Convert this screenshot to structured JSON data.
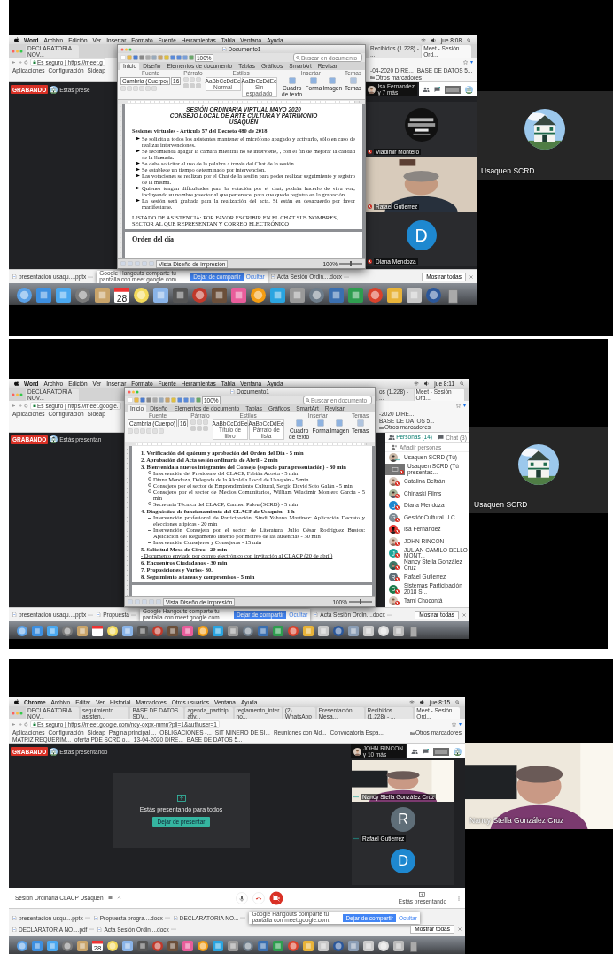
{
  "panels": [
    {
      "kind": "document",
      "menu_bar": {
        "app": "Word",
        "items": [
          "Archivo",
          "Edición",
          "Ver",
          "Insertar",
          "Formato",
          "Fuente",
          "Herramientas",
          "Tabla",
          "Ventana",
          "Ayuda"
        ],
        "clock": "jue 8:08"
      },
      "browser": {
        "tabs": {
          "left": [
            {
              "label": "DECLARATORIA NOV...",
              "selected": false
            }
          ],
          "right": [
            {
              "label": "Recibidos (1.228) - ...",
              "selected": false
            },
            {
              "label": "Meet - Sesión Ord...",
              "selected": true
            }
          ]
        },
        "address": "Es seguro | https://meet.g",
        "bookmarks": {
          "left": [
            "Aplicaciones",
            "Configuración",
            "Sideap"
          ],
          "right": [
            "-04-2020 DIRE...",
            "BASE DE DATOS 5...",
            "Otros marcadores"
          ]
        }
      },
      "meet": {
        "recording": "GRABANDO",
        "presenting": "Estás prese",
        "top_chip": {
          "name": "Isa Fernandez",
          "more": "y 7 más"
        },
        "tiles": [
          {
            "kind": "logo",
            "name": "Vladimir Montero",
            "muted": true
          },
          {
            "kind": "video",
            "name": "Rafael Gutierrez",
            "muted": true
          },
          {
            "kind": "letter",
            "letter": "D",
            "color": "#1e88d0",
            "name": "Diana Mendoza",
            "muted": true
          }
        ]
      },
      "word": {
        "title": "Documento1",
        "zoom": "100%",
        "search_placeholder": "Buscar en documento",
        "ribbon_tabs": [
          {
            "label": "Inicio",
            "selected": true
          },
          {
            "label": "Diseño",
            "selected": false
          },
          {
            "label": "Elementos de documento",
            "selected": false
          },
          {
            "label": "Tablas",
            "selected": false
          },
          {
            "label": "Gráficos",
            "selected": false
          },
          {
            "label": "SmartArt",
            "selected": false
          },
          {
            "label": "Revisar",
            "selected": false
          }
        ],
        "groups": [
          "Fuente",
          "Párrafo",
          "Estilos",
          "Insertar",
          "Temas"
        ],
        "font": "Cambria (Cuerpo)",
        "size": "16",
        "styles": [
          {
            "sample": "AaBbCcDdEe",
            "label": "Normal"
          },
          {
            "sample": "AaBbCcDdEe",
            "label": "Sin espaciado"
          }
        ],
        "insert": [
          "Cuadro de texto",
          "Forma",
          "Imagen"
        ],
        "themes": "Temas",
        "view": "Vista Diseño de impresión",
        "status_zoom": "100%",
        "zoom_slider": {
          "level": 0.5
        },
        "pages": [
          {
            "blocks": [
              {
                "kind": "title",
                "text": "SESIÓN ORDINARIA VIRTUAL MAYO 2020"
              },
              {
                "kind": "title",
                "text": "CONSEJO LOCAL DE ARTE CULTURA Y PATRIMONIO"
              },
              {
                "kind": "title",
                "text": "USAQUÉN"
              },
              {
                "kind": "heading",
                "text": "Sesiones virtuales - Artículo 57 del Decreto 480 de 2018"
              },
              {
                "kind": "bullet",
                "text": "Se solicita a todos los asistentes mantener el micrófono apagado y activarlo, sólo en caso de realizar intervenciones."
              },
              {
                "kind": "bullet",
                "text": "Se recomienda apagar la cámara mientras no se interviene, , con el fin de mejorar la calidad de la llamada."
              },
              {
                "kind": "bullet",
                "text": "Se debe solicitar el uso de la palabra a través del Chat de la sesión."
              },
              {
                "kind": "bullet",
                "text": "Se establece un tiempo determinado por intervención."
              },
              {
                "kind": "bullet",
                "text": "Las votaciones se realizan por el Chat de la sesión para poder realizar seguimiento y registro de la misma."
              },
              {
                "kind": "bullet",
                "text": "Quienes tengan dificultades para la votación por el chat, podrán hacerlo de viva voz, incluyendo su nombre y sector al que pertenece, para que quede registro en la grabación."
              },
              {
                "kind": "bullet",
                "text": "La sesión será grabada para la realización del acta. Si están en desacuerdo por favor manifestarse."
              },
              {
                "kind": "para",
                "text": "LISTADO DE ASISTENCIA: POR FAVOR ESCRIBIR EN EL CHAT SUS NOMBRES, SECTOR AL QUE REPRESENTAN Y CORREO ELECTRÓNICO"
              }
            ]
          },
          {
            "blocks": [
              {
                "kind": "section",
                "text": "Orden del día"
              }
            ]
          }
        ]
      },
      "downloads": {
        "left": [
          "presentacion usaqu....pptx"
        ],
        "right": [
          "Acta Sesión Ordin....docx"
        ],
        "show_all": "Mostrar todas"
      },
      "share_notice": {
        "text": "Google Hangouts comparte tu pantalla con meet.google.com.",
        "stop": "Dejar de compartir",
        "hide": "Ocultar"
      },
      "dock": {
        "calendar_day": "28"
      },
      "side_tile": {
        "kind": "avatar",
        "name": "Usaquen SCRD"
      }
    },
    {
      "kind": "document",
      "menu_bar": {
        "app": "Word",
        "items": [
          "Archivo",
          "Edición",
          "Ver",
          "Insertar",
          "Formato",
          "Fuente",
          "Herramientas",
          "Tabla",
          "Ventana",
          "Ayuda"
        ],
        "clock": "jue 8:11"
      },
      "browser": {
        "tabs": {
          "left": [
            {
              "label": "DECLARATORIA NOV...",
              "selected": false
            }
          ],
          "right": [
            {
              "label": "os (1.228) - ...",
              "selected": false
            },
            {
              "label": "Meet - Sesión Ord...",
              "selected": true
            }
          ]
        },
        "address": "Es seguro | https://meet.google.",
        "bookmarks": {
          "left": [
            "Aplicaciones",
            "Configuración",
            "Sideap"
          ],
          "right": [
            "-2020 DIRE...",
            "BASE DE DATOS 5...",
            "Otros marcadores"
          ]
        }
      },
      "meet": {
        "recording": "GRABANDO",
        "presenting": "Estás presentan",
        "people": {
          "tabs": [
            {
              "label": "Personas (14)",
              "selected": true
            },
            {
              "label": "Chat (3)",
              "selected": false
            }
          ],
          "add": "Añadir personas",
          "list": [
            {
              "name": "Usaquen SCRD (Tú)",
              "kind": "picture",
              "muted": false
            },
            {
              "name": "Usaquen SCRD (Tú presentas...",
              "kind": "screen",
              "muted": true
            },
            {
              "name": "Catalina Beltrán",
              "kind": "picture",
              "muted": true
            },
            {
              "name": "Chinaski Films",
              "kind": "picture",
              "muted": true
            },
            {
              "name": "Diana Mendoza",
              "kind": "letter",
              "letter": "D",
              "color": "#1e88d0",
              "muted": true
            },
            {
              "name": "GestiónCultural U.C",
              "kind": "letter",
              "letter": "G",
              "color": "#7d8a93",
              "muted": true
            },
            {
              "name": "Isa Fernandez",
              "kind": "picture",
              "muted": true
            },
            {
              "name": "JOHN RINCON",
              "kind": "picture",
              "muted": true
            },
            {
              "name": "JULIAN CAMILO BELLO MONT...",
              "kind": "letter",
              "letter": "J",
              "color": "#1ea59a",
              "muted": true
            },
            {
              "name": "Nancy Stella González Cruz",
              "kind": "picture",
              "muted": true
            },
            {
              "name": "Rafael Gutierrez",
              "kind": "letter",
              "letter": "R",
              "color": "#5f6e78",
              "muted": true
            },
            {
              "name": "Sistemas Participación 2018 S...",
              "kind": "letter",
              "letter": "S",
              "color": "#1b7a4a",
              "muted": true
            },
            {
              "name": "Tami Chocontá",
              "kind": "picture",
              "muted": true
            }
          ]
        }
      },
      "word": {
        "title": "Documento1",
        "zoom": "100%",
        "search_placeholder": "Buscar en documento",
        "ribbon_tabs": [
          {
            "label": "Inicio",
            "selected": true
          },
          {
            "label": "Diseño",
            "selected": false
          },
          {
            "label": "Elementos de documento",
            "selected": false
          },
          {
            "label": "Tablas",
            "selected": false
          },
          {
            "label": "Gráficos",
            "selected": false
          },
          {
            "label": "SmartArt",
            "selected": false
          },
          {
            "label": "Revisar",
            "selected": false
          }
        ],
        "groups": [
          "Fuente",
          "Párrafo",
          "Estilos",
          "Insertar",
          "Temas"
        ],
        "font": "Cambria (Cuerpo)",
        "size": "16",
        "styles": [
          {
            "sample": "AaBbCcDdEe",
            "label": "Título de libro"
          },
          {
            "sample": "AaBbCcDdEe",
            "label": "Párrafo de lista"
          }
        ],
        "insert": [
          "Cuadro de texto",
          "Forma",
          "Imagen"
        ],
        "themes": "Temas",
        "view": "Vista Diseño de impresión",
        "status_zoom": "100%",
        "zoom_slider": {
          "level": 0.5
        },
        "pages": [
          {
            "blocks": [
              {
                "kind": "item",
                "text": "1. Verificación del quórum y aprobación del Orden del Día - 5 min"
              },
              {
                "kind": "item",
                "text": "2. Aprobación del Acta sesión ordinaria de Abril - 2 min"
              },
              {
                "kind": "item",
                "text": "3. Bienvenida a nuevos integrantes del Consejo (espacio para presentación) - 30 min"
              },
              {
                "kind": "sub-circle",
                "text": "Intervención del Presidente del CLACP, Fabián Acosta - 5 min"
              },
              {
                "kind": "sub-circle",
                "text": "Diana Mendoza, Delegada de la Alcaldía Local de Usaquén - 5 min"
              },
              {
                "kind": "sub-circle",
                "text": "Consejero por el sector de Emprendimiento Cultural, Sergio David Soto Galán - 5 min"
              },
              {
                "kind": "sub-circle",
                "text": "Consejero por el sector de Medios Comunitarios, William Wladimir Montero García - 5 min"
              },
              {
                "kind": "sub-circle",
                "text": "Secretaría Técnica del CLACP, Carmen Palou (SCRD) - 5 min"
              },
              {
                "kind": "item",
                "text": "4. Diagnóstico de funcionamiento del CLACP de Usaquén - 1 h"
              },
              {
                "kind": "sub-dash",
                "text": "Intervención profesional de Participación, Sindi Yohana Martínez: Aplicación Decreto y elecciones atípicas - 20 min"
              },
              {
                "kind": "sub-dash",
                "text": "Intervención Consejera por el sector de Literatura, Julio César Rodríguez Bustos: Aplicación del Reglamento Interno por motivo de las ausencias - 30 min"
              },
              {
                "kind": "sub-dash",
                "text": "Intervención Consejeros y Consejeras - 15 min"
              },
              {
                "kind": "item",
                "text": "5. Solicitud Mesa de Circo - 20 min"
              },
              {
                "kind": "note",
                "text": "- Documento enviado por correo electrónico con invitación al CLACP (20 de abril)"
              },
              {
                "kind": "item",
                "text": "6. Encuentros Ciudadanos - 30 min"
              },
              {
                "kind": "item",
                "text": "7. Proposiciones y Varios- 30."
              },
              {
                "kind": "item",
                "text": "8. Seguimiento a tareas y compromisos - 5 min"
              }
            ]
          }
        ]
      },
      "downloads": {
        "left": [
          "presentacion usaqu....pptx",
          "Propuesta"
        ],
        "right": [
          "Acta Sesión Ordin....docx"
        ],
        "show_all": "Mostrar todas"
      },
      "share_notice": {
        "text": "Google Hangouts comparte tu pantalla con meet.google.com.",
        "stop": "Dejar de compartir",
        "hide": "Ocultar"
      },
      "side_tile": {
        "kind": "avatar",
        "name": "Usaquen SCRD"
      }
    },
    {
      "kind": "presentation",
      "menu_bar": {
        "app": "Chrome",
        "items": [
          "Archivo",
          "Editar",
          "Ver",
          "Historial",
          "Marcadores",
          "Otros usuarios",
          "Ventana",
          "Ayuda"
        ],
        "clock": "jue 8:15"
      },
      "browser": {
        "tabs": {
          "left": [
            {
              "label": "DECLARATORIA NOV...",
              "selected": false
            },
            {
              "label": "seguimiento asisten...",
              "selected": false
            },
            {
              "label": "BASE DE DATOS SDV...",
              "selected": false
            },
            {
              "label": "agenda_participativ...",
              "selected": false
            },
            {
              "label": "reglamento_interno...",
              "selected": false
            },
            {
              "label": "(2) WhatsApp",
              "selected": false
            },
            {
              "label": "Presentación Mesa...",
              "selected": false
            },
            {
              "label": "Recibidos (1.228) - ...",
              "selected": false
            },
            {
              "label": "Meet - Sesión Ord...",
              "selected": true
            }
          ]
        },
        "address": "Es seguro | https://meet.google.com/ncy-oxpx-mmn?pli=1&authuser=1",
        "bookmarks": {
          "left": [
            "Aplicaciones",
            "Configuración",
            "Sideap",
            "Pagina principal ...",
            "OBLIGACIONES -...",
            "SIT MINERO DE SI...",
            "Reuniones con Ald...",
            "Convocatoria Espa...",
            "MATRIZ REQUERIM...",
            "oferta PDE SCRD o...",
            "13-04-2020 DIRE...",
            "BASE DE DATOS 5..."
          ],
          "right": [
            "Otros marcadores"
          ]
        }
      },
      "meet": {
        "recording": "GRABANDO",
        "presenting": "Estás presentando",
        "top_chip": {
          "name": "JOHN RINCON",
          "more": "y 10 más"
        },
        "tiles": [
          {
            "kind": "video",
            "name": "Nancy Stella González Cruz",
            "muted": false
          },
          {
            "kind": "letter",
            "letter": "R",
            "color": "#5f6e78",
            "name": "Rafael Gutierrez",
            "muted": false
          },
          {
            "kind": "letter",
            "letter": "D",
            "color": "#1e88d0"
          }
        ],
        "presentation_card": {
          "text": "Estás presentando para todos",
          "button": "Dejar de presentar"
        },
        "call_bar": {
          "title": "Sesión Ordinaria CLACP Usaquén",
          "presenting": "Estás presentando"
        }
      },
      "downloads": {
        "left": [
          "presentacion usqu....pptx",
          "Propuesta progra....docx",
          "DECLARATORIA NO..."
        ],
        "right": [
          "DECLARATORIA NO....pdf",
          "Acta Sesión Ordin....docx"
        ],
        "show_all": "Mostrar todas"
      },
      "share_notice": {
        "text": "Google Hangouts comparte tu pantalla con meet.google.com.",
        "stop": "Dejar de compartir",
        "hide": "Ocultar"
      },
      "dock": {
        "calendar_day": "28"
      },
      "side_tile": {
        "kind": "video",
        "name": "Nancy Stella González Cruz"
      }
    }
  ]
}
